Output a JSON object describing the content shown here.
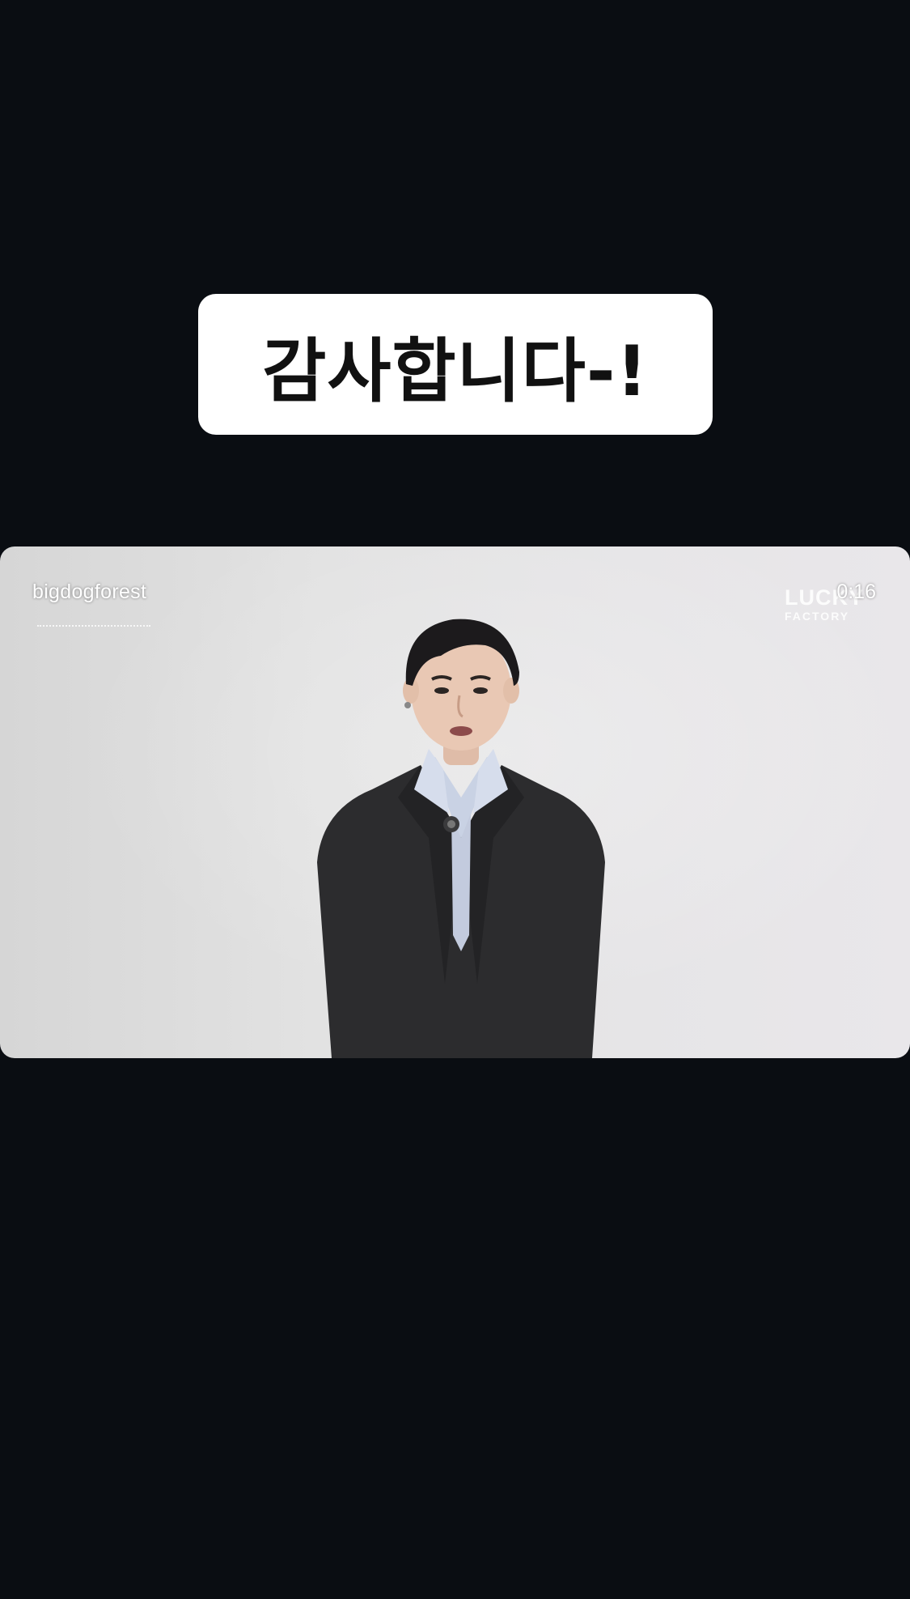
{
  "story": {
    "caption": "감사합니다-!",
    "video": {
      "username": "bigdogforest",
      "timestamp": "0:16",
      "show_logo_text": "",
      "channel_logo_line1": "LUCKY",
      "channel_logo_line2": "FACTORY"
    }
  },
  "colors": {
    "background": "#0a0d12",
    "sticker": "#ffffff",
    "caption_text": "#111111",
    "wall": "#e2e2e2",
    "jacket": "#2c2c2e",
    "shirt": "#c9d2e4",
    "hair": "#1c1a1c",
    "skin": "#e9c8b4"
  }
}
